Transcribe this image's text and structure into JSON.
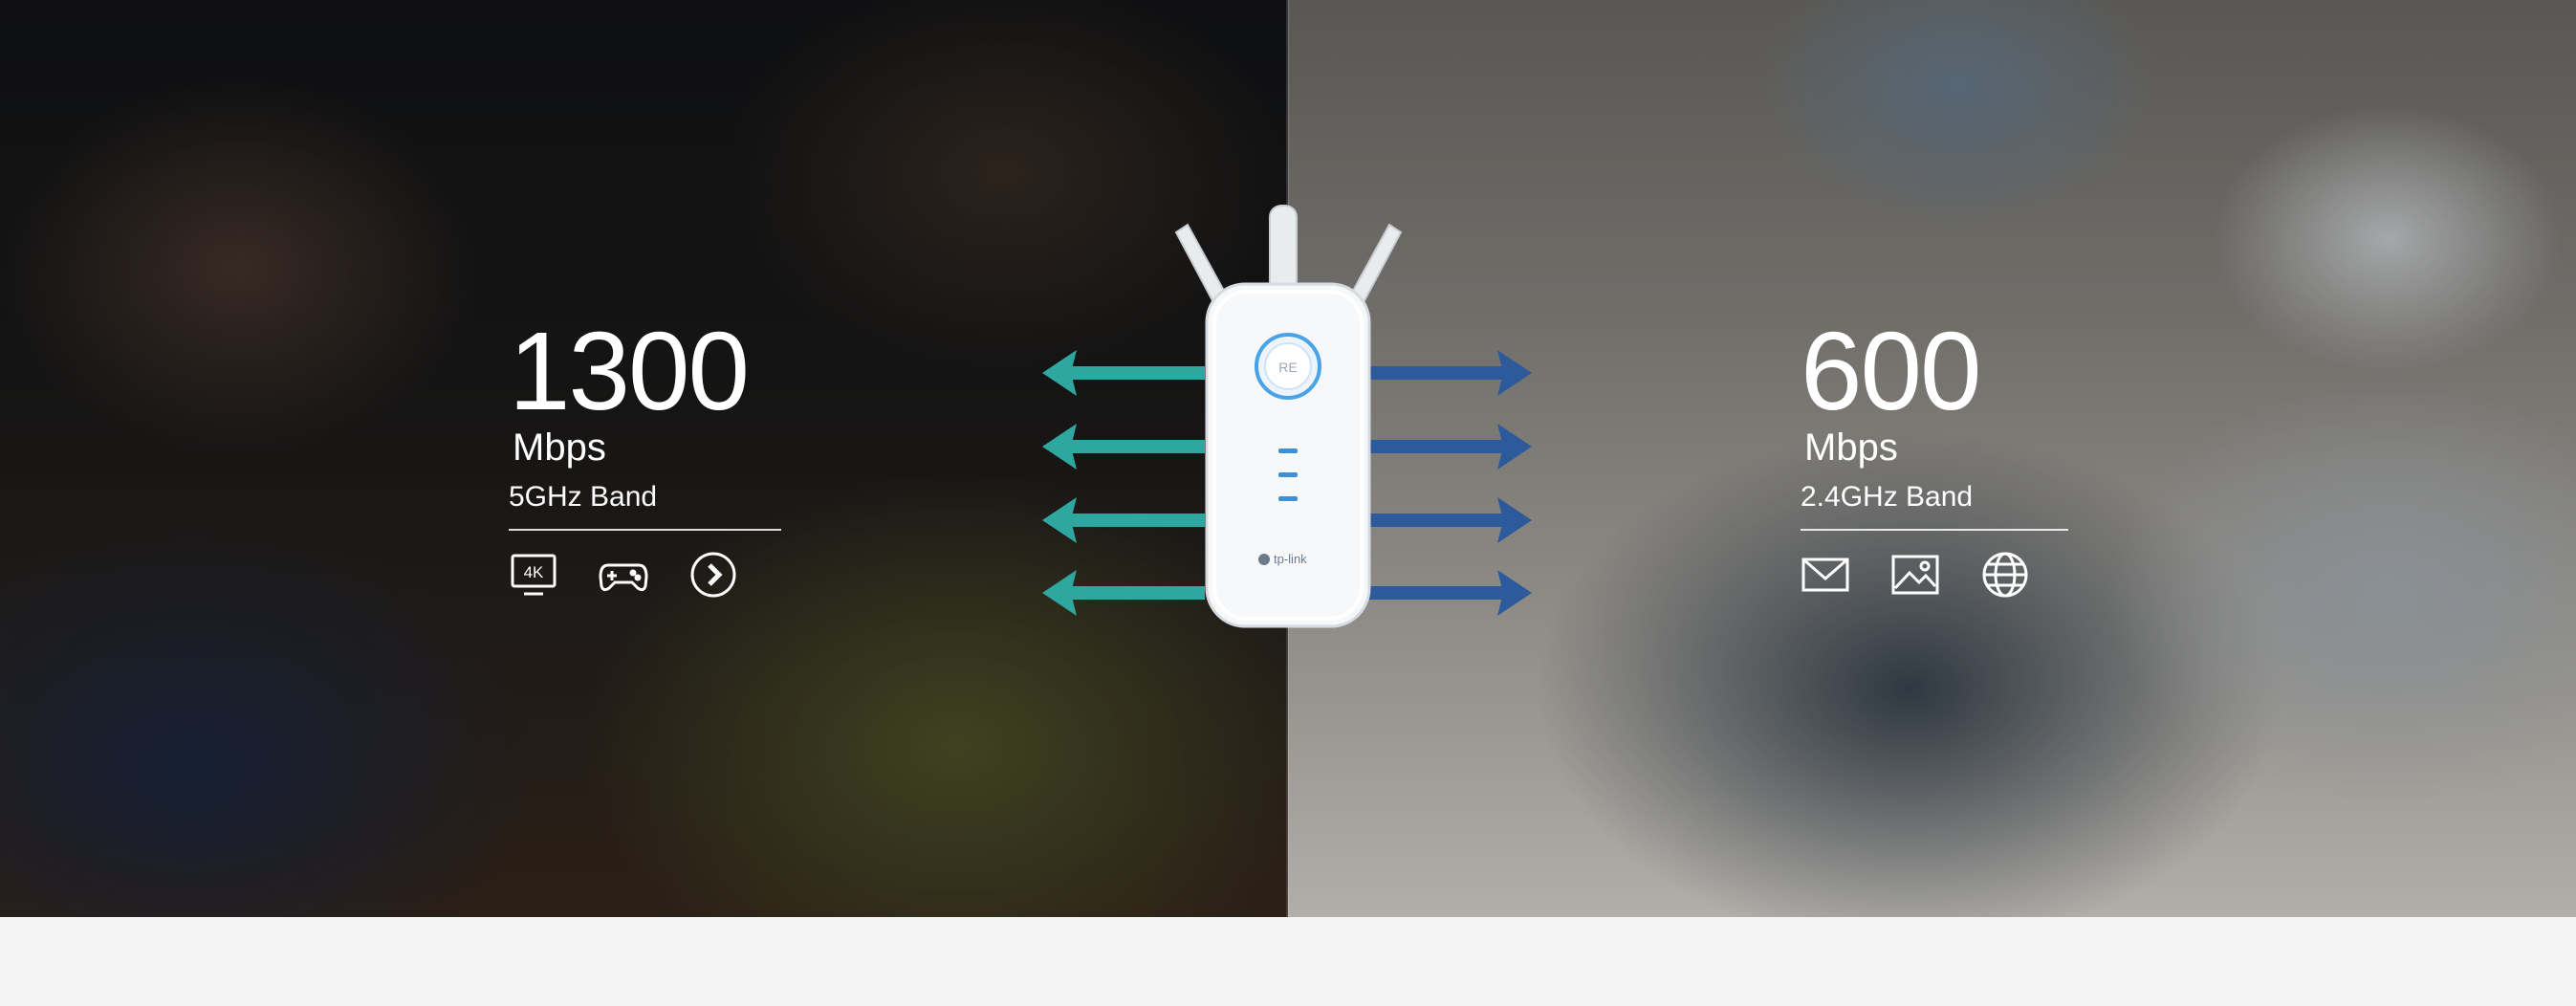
{
  "left_band": {
    "speed": "1300",
    "unit": "Mbps",
    "band": "5GHz Band",
    "icons": [
      "4k-tv-icon",
      "gamepad-icon",
      "play-icon"
    ],
    "icon_4k_label": "4K"
  },
  "right_band": {
    "speed": "600",
    "unit": "Mbps",
    "band": "2.4GHz Band",
    "icons": [
      "mail-icon",
      "image-icon",
      "globe-icon"
    ]
  },
  "device": {
    "brand": "tp-link",
    "button_label": "RE"
  },
  "colors": {
    "arrow_left": "#2ea7a1",
    "arrow_right": "#2d5a9b",
    "footer_bg": "#f4f4f4"
  }
}
